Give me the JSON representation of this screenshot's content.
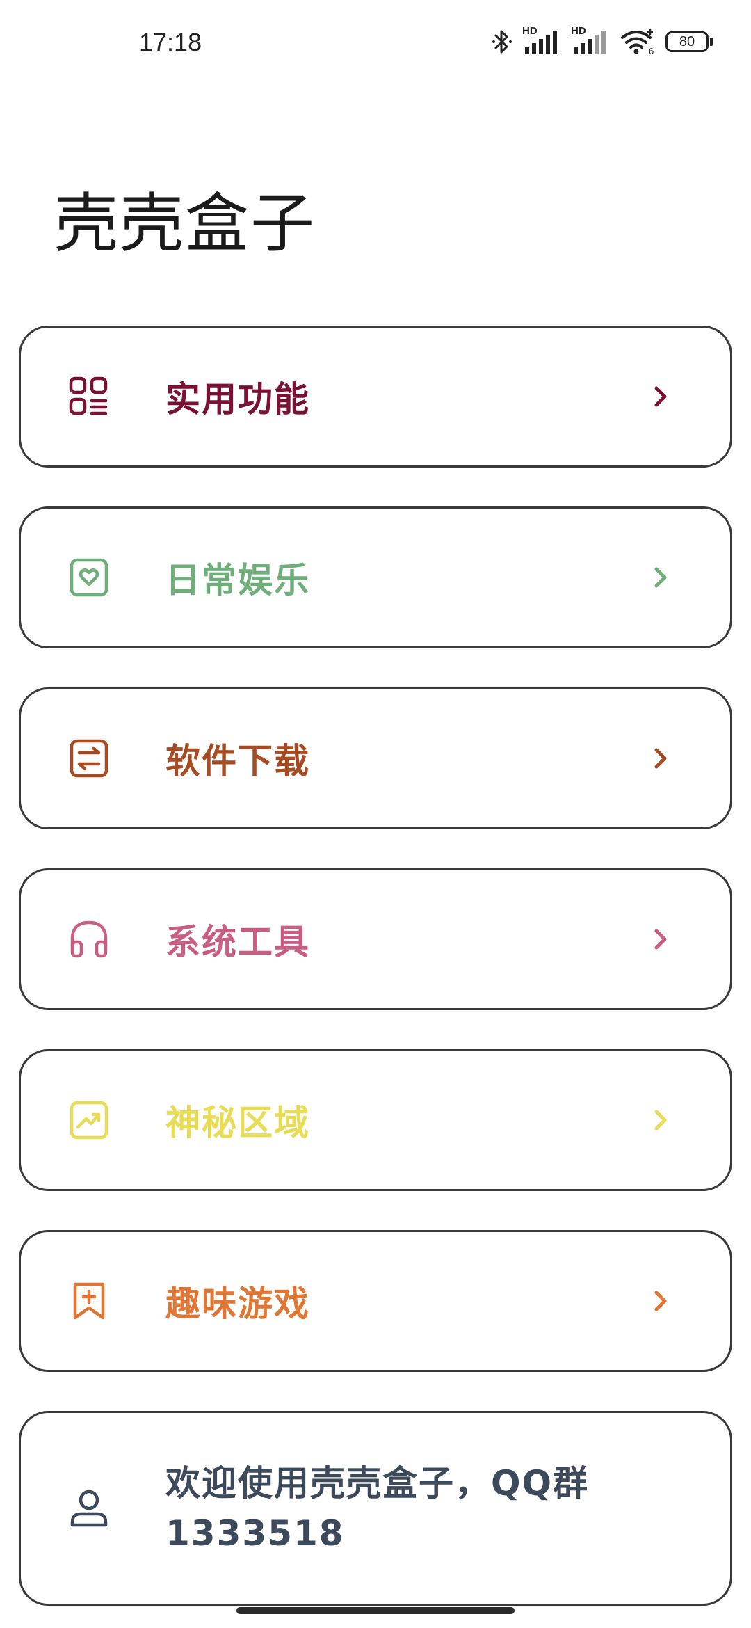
{
  "status_bar": {
    "time": "17:18",
    "hd1": "HD",
    "hd2": "HD",
    "wifi_badge": "6",
    "battery": "80"
  },
  "app": {
    "title": "壳壳盒子"
  },
  "menu": [
    {
      "label": "实用功能",
      "color": "#7a1236",
      "icon": "grid-apps-icon"
    },
    {
      "label": "日常娱乐",
      "color": "#6fae7a",
      "icon": "heart-square-icon"
    },
    {
      "label": "软件下载",
      "color": "#a64b22",
      "icon": "transfer-square-icon"
    },
    {
      "label": "系统工具",
      "color": "#c95e85",
      "icon": "headphones-icon"
    },
    {
      "label": "神秘区域",
      "color": "#e8dc56",
      "icon": "trending-square-icon"
    },
    {
      "label": "趣味游戏",
      "color": "#e07634",
      "icon": "bookmark-plus-icon"
    }
  ],
  "info": {
    "text": "欢迎使用壳壳盒子，QQ群1333518",
    "color": "#3d4a5c",
    "icon": "user-icon"
  }
}
